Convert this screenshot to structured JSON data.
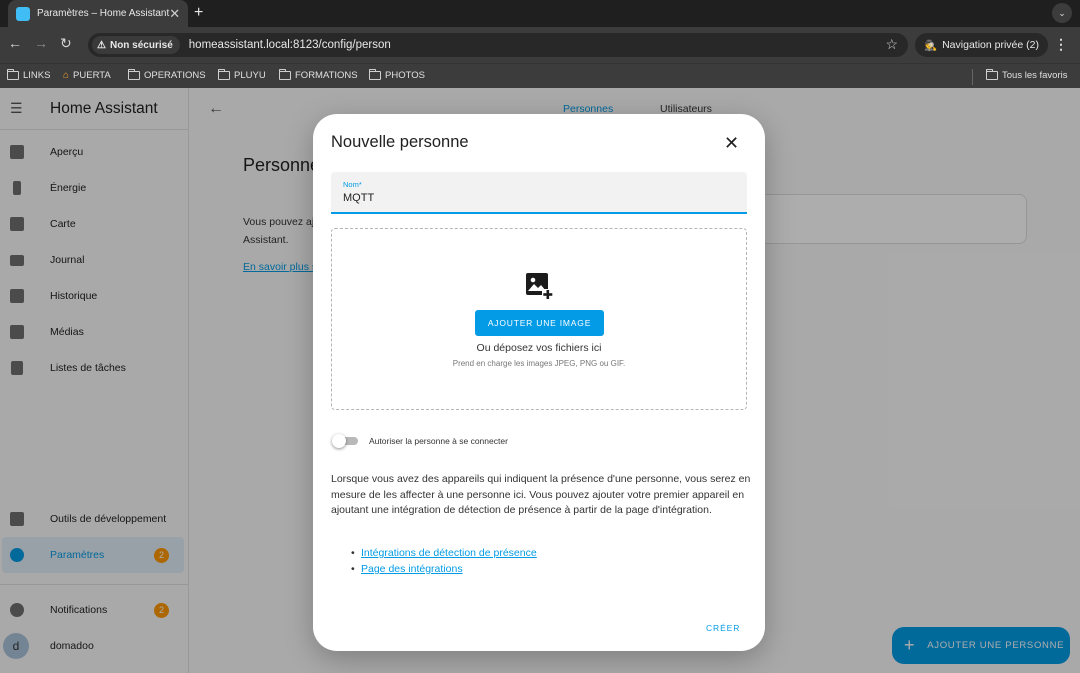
{
  "browser": {
    "tab_title": "Paramètres – Home Assistant",
    "insecure_label": "Non sécurisé",
    "url": "homeassistant.local:8123/config/person",
    "private_label": "Navigation privée (2)",
    "bookmarks": [
      "LINKS",
      "PUERTA",
      "OPERATIONS",
      "PLUYU",
      "FORMATIONS",
      "PHOTOS"
    ],
    "all_bookmarks": "Tous les favoris"
  },
  "sidebar": {
    "title": "Home Assistant",
    "items": [
      {
        "label": "Aperçu",
        "icon": "dashboard-icon"
      },
      {
        "label": "Énergie",
        "icon": "lightning-icon"
      },
      {
        "label": "Carte",
        "icon": "map-icon"
      },
      {
        "label": "Journal",
        "icon": "list-icon"
      },
      {
        "label": "Historique",
        "icon": "chart-icon"
      },
      {
        "label": "Médias",
        "icon": "media-icon"
      },
      {
        "label": "Listes de tâches",
        "icon": "clipboard-icon"
      }
    ],
    "dev_tools": "Outils de développement",
    "settings": "Paramètres",
    "settings_badge": "2",
    "notifications": "Notifications",
    "notifications_badge": "2",
    "user_initial": "d",
    "user_name": "domadoo"
  },
  "main": {
    "tabs": [
      "Personnes",
      "Utilisateurs"
    ],
    "heading": "Personne",
    "text_line1": "Vous pouvez aj",
    "text_line2": "Assistant.",
    "link": "En savoir plus s",
    "fab_label": "AJOUTER UNE PERSONNE"
  },
  "dialog": {
    "title": "Nouvelle personne",
    "name_label": "Nom*",
    "name_value": "MQTT",
    "upload_button": "AJOUTER UNE IMAGE",
    "drop_text": "Ou déposez vos fichiers ici",
    "support_text": "Prend en charge les images JPEG, PNG ou GIF.",
    "allow_login_label": "Autoriser la personne à se connecter",
    "allow_login_enabled": false,
    "info_text": "Lorsque vous avez des appareils qui indiquent la présence d'une personne, vous serez en mesure de les affecter à une personne ici. Vous pouvez ajouter votre premier appareil en ajoutant une intégration de détection de présence à partir de la page d'intégration.",
    "links": [
      "Intégrations de détection de présence",
      "Page des intégrations"
    ],
    "create_button": "CRÉER"
  },
  "colors": {
    "accent": "#039be5",
    "badge": "#ff9800"
  }
}
